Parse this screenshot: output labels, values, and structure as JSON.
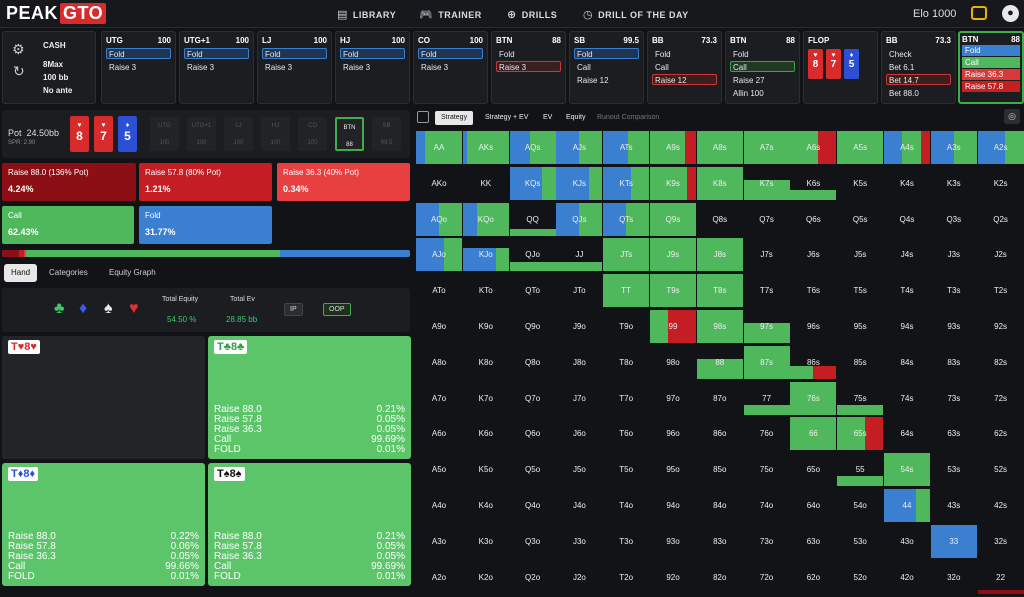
{
  "app": {
    "logo_a": "PEAK",
    "logo_b": "GTO",
    "elo": "Elo 1000",
    "nav": [
      {
        "icon": "library-icon",
        "glyph": "▤",
        "label": "LIBRARY"
      },
      {
        "icon": "trainer-icon",
        "glyph": "🎮",
        "label": "TRAINER"
      },
      {
        "icon": "drills-icon",
        "glyph": "⊕",
        "label": "DRILLS"
      },
      {
        "icon": "clock-icon",
        "glyph": "◷",
        "label": "DRILL OF THE DAY"
      }
    ]
  },
  "game": {
    "type": "CASH",
    "players": "8Max",
    "stack": "100 bb",
    "ante": "No ante"
  },
  "positions": [
    {
      "name": "UTG",
      "stack": "100",
      "actions": [
        {
          "t": "Fold",
          "s": "fold"
        },
        {
          "t": "Raise 3",
          "s": ""
        }
      ]
    },
    {
      "name": "UTG+1",
      "stack": "100",
      "actions": [
        {
          "t": "Fold",
          "s": "fold"
        },
        {
          "t": "Raise 3",
          "s": ""
        }
      ]
    },
    {
      "name": "LJ",
      "stack": "100",
      "actions": [
        {
          "t": "Fold",
          "s": "fold"
        },
        {
          "t": "Raise 3",
          "s": ""
        }
      ]
    },
    {
      "name": "HJ",
      "stack": "100",
      "actions": [
        {
          "t": "Fold",
          "s": "fold"
        },
        {
          "t": "Raise 3",
          "s": ""
        }
      ]
    },
    {
      "name": "CO",
      "stack": "100",
      "actions": [
        {
          "t": "Fold",
          "s": "fold"
        },
        {
          "t": "Raise 3",
          "s": ""
        }
      ]
    },
    {
      "name": "BTN",
      "stack": "88",
      "actions": [
        {
          "t": "Fold",
          "s": ""
        },
        {
          "t": "Raise 3",
          "s": "raise"
        }
      ]
    },
    {
      "name": "SB",
      "stack": "99.5",
      "actions": [
        {
          "t": "Fold",
          "s": "fold"
        },
        {
          "t": "Call",
          "s": ""
        },
        {
          "t": "Raise 12",
          "s": ""
        }
      ]
    },
    {
      "name": "BB",
      "stack": "73.3",
      "actions": [
        {
          "t": "Fold",
          "s": ""
        },
        {
          "t": "Call",
          "s": ""
        },
        {
          "t": "Raise 12",
          "s": "raise"
        }
      ]
    },
    {
      "name": "BTN",
      "stack": "88",
      "actions": [
        {
          "t": "Fold",
          "s": ""
        },
        {
          "t": "Call",
          "s": "call"
        },
        {
          "t": "Raise 27",
          "s": ""
        },
        {
          "t": "Allin 100",
          "s": ""
        }
      ]
    }
  ],
  "flop": {
    "label": "FLOP",
    "cards": [
      {
        "r": "8",
        "s": "♥",
        "c": "red"
      },
      {
        "r": "7",
        "s": "♥",
        "c": "red"
      },
      {
        "r": "5",
        "s": "♦",
        "c": "blue"
      }
    ]
  },
  "bb_card": {
    "name": "BB",
    "stack": "73.3",
    "actions": [
      {
        "t": "Check",
        "s": ""
      },
      {
        "t": "Bet 6.1",
        "s": ""
      },
      {
        "t": "Bet 14.7",
        "s": "raise"
      },
      {
        "t": "Bet 88.0",
        "s": ""
      }
    ]
  },
  "btn_active": {
    "name": "BTN",
    "stack": "88",
    "fills": [
      {
        "t": "Fold",
        "c": "#3a7fd0"
      },
      {
        "t": "Call",
        "c": "#4fb85c"
      },
      {
        "t": "Raise 36.3",
        "c": "#d83a3a"
      },
      {
        "t": "Raise 57.8",
        "c": "#c42020"
      }
    ]
  },
  "pot": {
    "label": "Pot",
    "value": "24.50bb",
    "spr": "SPR: 2.90",
    "cards": [
      {
        "r": "8",
        "s": "♥",
        "c": "red"
      },
      {
        "r": "7",
        "s": "♥",
        "c": "red"
      },
      {
        "r": "5",
        "s": "♦",
        "c": "blue"
      }
    ],
    "seats": [
      {
        "n": "UTG",
        "v": "100"
      },
      {
        "n": "UTG+1",
        "v": "100"
      },
      {
        "n": "LJ",
        "v": "100"
      },
      {
        "n": "HJ",
        "v": "100"
      },
      {
        "n": "CO",
        "v": "100"
      },
      {
        "n": "BTN",
        "v": "88",
        "on": true
      },
      {
        "n": "SB",
        "v": "99.5"
      }
    ]
  },
  "actions": [
    {
      "label": "Raise 88.0 (136% Pot)",
      "freq": "4.24%",
      "color": "#8b0f14"
    },
    {
      "label": "Raise 57.8 (80% Pot)",
      "freq": "1.21%",
      "color": "#c41e24"
    },
    {
      "label": "Raise 36.3 (40% Pot)",
      "freq": "0.34%",
      "color": "#e84040"
    },
    {
      "label": "Call",
      "freq": "62.43%",
      "color": "#4fb85c"
    },
    {
      "label": "Fold",
      "freq": "31.77%",
      "color": "#3a7fd0"
    }
  ],
  "freq_bar": [
    {
      "c": "#8b0f14",
      "f": 0.0424
    },
    {
      "c": "#c41e24",
      "f": 0.0121
    },
    {
      "c": "#e84040",
      "f": 0.0034
    },
    {
      "c": "#4fb85c",
      "f": 0.6243
    },
    {
      "c": "#3a7fd0",
      "f": 0.3177
    }
  ],
  "tabs": [
    "Hand",
    "Categories",
    "Equity Graph"
  ],
  "equity": {
    "total_equity_label": "Total Equity",
    "total_equity": "54.50 %",
    "total_ev_label": "Total Ev",
    "total_ev": "28.85 bb",
    "ip": "IP",
    "oop": "OOP",
    "suits": [
      {
        "g": "♣",
        "c": "#3fc66e",
        "n": "club-icon"
      },
      {
        "g": "♦",
        "c": "#3a5ce8",
        "n": "diamond-icon"
      },
      {
        "g": "♠",
        "c": "#e8e8e8",
        "n": "spade-icon"
      },
      {
        "g": "♥",
        "c": "#e03030",
        "n": "heart-icon"
      }
    ]
  },
  "combos": [
    {
      "hand": "T♥8♥",
      "c": "#d82c2c",
      "empty": true,
      "rows": []
    },
    {
      "hand": "T♣8♣",
      "c": "#2e9e45",
      "empty": false,
      "rows": [
        {
          "a": "Raise 88.0",
          "v": "0.21%"
        },
        {
          "a": "Raise 57.8",
          "v": "0.05%"
        },
        {
          "a": "Raise 36.3",
          "v": "0.05%"
        },
        {
          "a": "Call",
          "v": "99.69%"
        },
        {
          "a": "FOLD",
          "v": "0.01%"
        }
      ]
    },
    {
      "hand": "T♦8♦",
      "c": "#2d4fd6",
      "empty": false,
      "rows": [
        {
          "a": "Raise 88.0",
          "v": "0.22%"
        },
        {
          "a": "Raise 57.8",
          "v": "0.06%"
        },
        {
          "a": "Raise 36.3",
          "v": "0.05%"
        },
        {
          "a": "Call",
          "v": "99.66%"
        },
        {
          "a": "FOLD",
          "v": "0.01%"
        }
      ]
    },
    {
      "hand": "T♠8♠",
      "c": "#111",
      "empty": false,
      "rows": [
        {
          "a": "Raise 88.0",
          "v": "0.21%"
        },
        {
          "a": "Raise 57.8",
          "v": "0.05%"
        },
        {
          "a": "Raise 36.3",
          "v": "0.05%"
        },
        {
          "a": "Call",
          "v": "99.69%"
        },
        {
          "a": "FOLD",
          "v": "0.01%"
        }
      ]
    }
  ],
  "strategy_tabs": [
    "Strategy",
    "Strategy + EV",
    "EV",
    "Equity",
    "Runout Comparison"
  ],
  "grid": {
    "ranks": [
      "A",
      "K",
      "Q",
      "J",
      "T",
      "9",
      "8",
      "7",
      "6",
      "5",
      "4",
      "3",
      "2"
    ],
    "cells": {
      "AA": [
        0.2,
        0.8,
        0,
        0
      ],
      "AKs": [
        0.1,
        0.9,
        0,
        0
      ],
      "AQs": [
        0.45,
        0.55,
        0,
        0
      ],
      "AJs": [
        0.5,
        0.5,
        0,
        0
      ],
      "ATs": [
        0.55,
        0.45,
        0,
        0
      ],
      "A9s": [
        0,
        0.75,
        0.25,
        0
      ],
      "A8s": [
        0,
        1,
        0,
        0
      ],
      "A7s": [
        0,
        1,
        0,
        0
      ],
      "A6s": [
        0,
        0.6,
        0.4,
        0
      ],
      "A5s": [
        0,
        1,
        0,
        0
      ],
      "A4s": [
        0.4,
        0.4,
        0.2,
        0
      ],
      "A3s": [
        0.5,
        0.5,
        0,
        0
      ],
      "A2s": [
        0.6,
        0.4,
        0,
        0
      ],
      "KQs": [
        0.7,
        0.3,
        0,
        0
      ],
      "KJs": [
        0.7,
        0.3,
        0,
        0
      ],
      "KTs": [
        0.6,
        0.4,
        0,
        0
      ],
      "K9s": [
        0,
        0.8,
        0.2,
        0
      ],
      "K8s": [
        0,
        1,
        0,
        0
      ],
      "K7s": [
        0,
        0.6,
        0,
        0
      ],
      "K6s": [
        0,
        0.3,
        0,
        0
      ],
      "AQo": [
        0.5,
        0.5,
        0,
        0
      ],
      "KQo": [
        0.3,
        0.7,
        0,
        0
      ],
      "QQ": [
        0,
        0.2,
        0,
        0
      ],
      "QJs": [
        0.5,
        0.5,
        0,
        0
      ],
      "QTs": [
        0.5,
        0.5,
        0,
        0
      ],
      "Q9s": [
        0,
        1,
        0,
        0
      ],
      "AJo": [
        0.6,
        0.4,
        0,
        0
      ],
      "KJo": [
        0.5,
        0.2,
        0,
        0
      ],
      "QJo": [
        0,
        0.3,
        0,
        0
      ],
      "JJ": [
        0,
        0.3,
        0,
        0
      ],
      "JTs": [
        0,
        1,
        0,
        0
      ],
      "J9s": [
        0,
        1,
        0,
        0
      ],
      "J8s": [
        0,
        1,
        0,
        0
      ],
      "TT": [
        0,
        1,
        0,
        0
      ],
      "T9s": [
        0,
        1,
        0,
        0
      ],
      "T8s": [
        0,
        1,
        0,
        0
      ],
      "99": [
        0,
        0.4,
        0.6,
        0
      ],
      "98s": [
        0,
        1,
        0,
        0
      ],
      "97s": [
        0,
        0.6,
        0,
        0
      ],
      "88": [
        0,
        0.6,
        0,
        0
      ],
      "87s": [
        0,
        1,
        0,
        0
      ],
      "86s": [
        0,
        0.2,
        0.2,
        0
      ],
      "77": [
        0,
        0.3,
        0,
        0
      ],
      "76s": [
        0,
        1,
        0,
        0
      ],
      "75s": [
        0,
        0.3,
        0,
        0
      ],
      "66": [
        0,
        1,
        0,
        0
      ],
      "65s": [
        0,
        0.6,
        0.4,
        0
      ],
      "55": [
        0,
        0.3,
        0,
        0
      ],
      "54s": [
        0,
        1,
        0,
        0
      ],
      "44": [
        0.7,
        0.3,
        0,
        0
      ],
      "33": [
        1,
        0,
        0,
        0
      ],
      "22": [
        0,
        0,
        0,
        0.1
      ]
    }
  }
}
